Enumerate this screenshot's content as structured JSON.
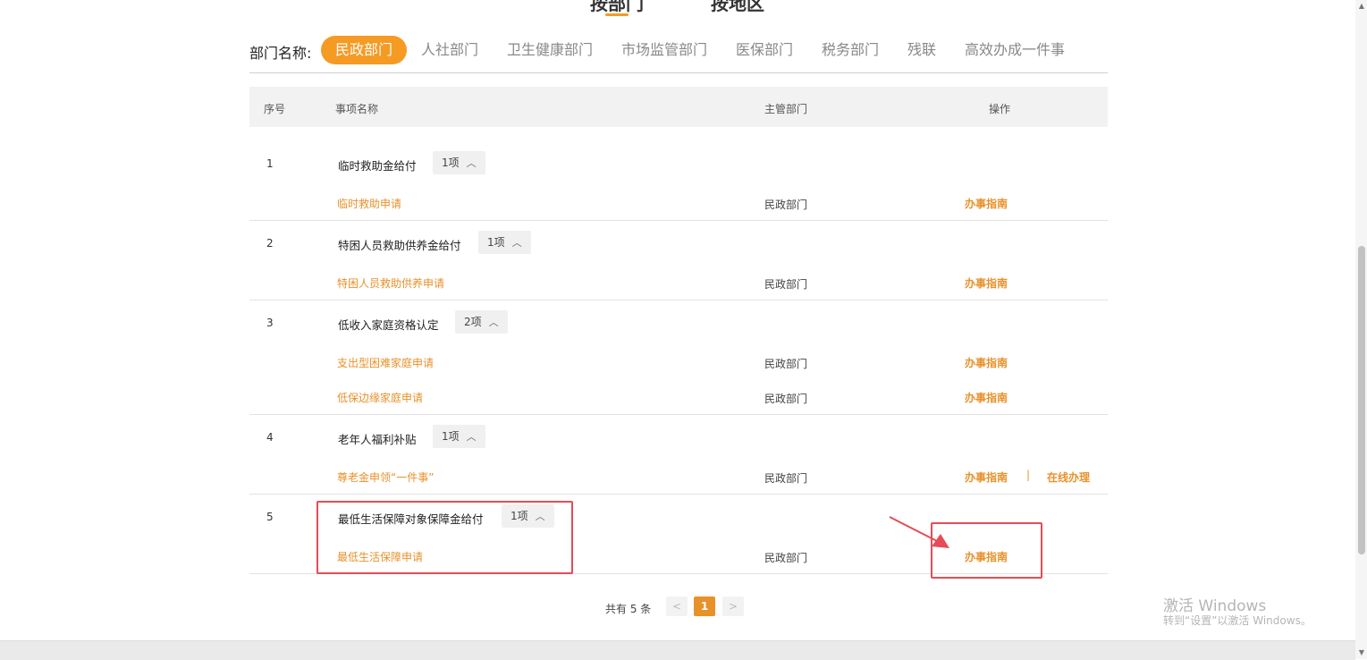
{
  "top_tabs": [
    "按部门",
    "按地区"
  ],
  "dept_filter": {
    "label": "部门名称:",
    "items": [
      "民政部门",
      "人社部门",
      "卫生健康部门",
      "市场监管部门",
      "医保部门",
      "税务部门",
      "残联",
      "高效办成一件事"
    ],
    "active": "民政部门"
  },
  "table": {
    "headers": {
      "num": "序号",
      "name": "事项名称",
      "dept": "主管部门",
      "op": "操作"
    },
    "groups": [
      {
        "num": "1",
        "title": "临时救助金给付",
        "count": "1项",
        "items": [
          {
            "name": "临时救助申请",
            "dept": "民政部门",
            "ops": [
              "办事指南"
            ]
          }
        ]
      },
      {
        "num": "2",
        "title": "特困人员救助供养金给付",
        "count": "1项",
        "items": [
          {
            "name": "特困人员救助供养申请",
            "dept": "民政部门",
            "ops": [
              "办事指南"
            ]
          }
        ]
      },
      {
        "num": "3",
        "title": "低收入家庭资格认定",
        "count": "2项",
        "items": [
          {
            "name": "支出型困难家庭申请",
            "dept": "民政部门",
            "ops": [
              "办事指南"
            ]
          },
          {
            "name": "低保边缘家庭申请",
            "dept": "民政部门",
            "ops": [
              "办事指南"
            ]
          }
        ]
      },
      {
        "num": "4",
        "title": "老年人福利补贴",
        "count": "1项",
        "items": [
          {
            "name": "尊老金申领“一件事”",
            "dept": "民政部门",
            "ops": [
              "办事指南",
              "在线办理"
            ]
          }
        ]
      },
      {
        "num": "5",
        "title": "最低生活保障对象保障金给付",
        "count": "1项",
        "items": [
          {
            "name": "最低生活保障申请",
            "dept": "民政部门",
            "ops": [
              "办事指南"
            ]
          }
        ]
      }
    ],
    "op_separator": "|",
    "collapse_icon": "chevron-up-icon"
  },
  "pagination": {
    "total": "共有 5 条",
    "prev": "<",
    "current": "1",
    "next": ">"
  },
  "watermark": {
    "line1": "激活 Windows",
    "line2": "转到“设置”以激活 Windows。"
  },
  "colors": {
    "accent": "#f59a23",
    "link": "#e8912b",
    "highlight": "#e54c57"
  }
}
